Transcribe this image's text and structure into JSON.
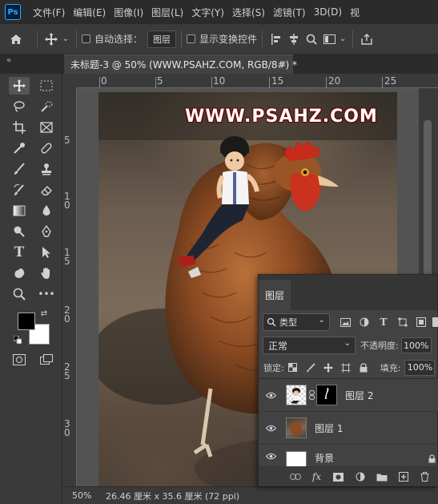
{
  "app": {
    "logo": "Ps"
  },
  "menu": [
    "文件(F)",
    "编辑(E)",
    "图像(I)",
    "图层(L)",
    "文字(Y)",
    "选择(S)",
    "滤镜(T)",
    "3D(D)",
    "视"
  ],
  "options": {
    "auto_select_label": "自动选择：",
    "auto_select_target": "图层",
    "show_transform_label": "显示变换控件"
  },
  "document_tab": {
    "title": "未标题-3 @ 50% (WWW.PSAHZ.COM, RGB/8#) *",
    "close": "×"
  },
  "ruler": {
    "top_labels": [
      "0",
      "5",
      "10",
      "15",
      "20",
      "25"
    ],
    "left_labels": [
      "5",
      "1\n0",
      "1\n5",
      "2\n0",
      "2\n5",
      "3\n0"
    ]
  },
  "canvas": {
    "watermark": "WWW.PSAHZ.COM"
  },
  "status": {
    "zoom": "50%",
    "doc_info": "26.46 厘米 x 35.6 厘米 (72 ppi)"
  },
  "layers_panel": {
    "tab_label": "图层",
    "filter_kind": "类型",
    "blend_mode": "正常",
    "opacity_label": "不透明度:",
    "opacity_value": "100%",
    "lock_label": "锁定:",
    "fill_label": "填充:",
    "fill_value": "100%",
    "layers": [
      {
        "name": "图层 2",
        "has_mask": true
      },
      {
        "name": "图层 1",
        "has_mask": false
      },
      {
        "name": "背景",
        "locked": true
      }
    ]
  },
  "colors": {
    "accent": "#31a8ff",
    "watermark_stroke": "#6b0000",
    "hen_red": "#c52a1a",
    "hen_brown": "#8b4a22"
  }
}
